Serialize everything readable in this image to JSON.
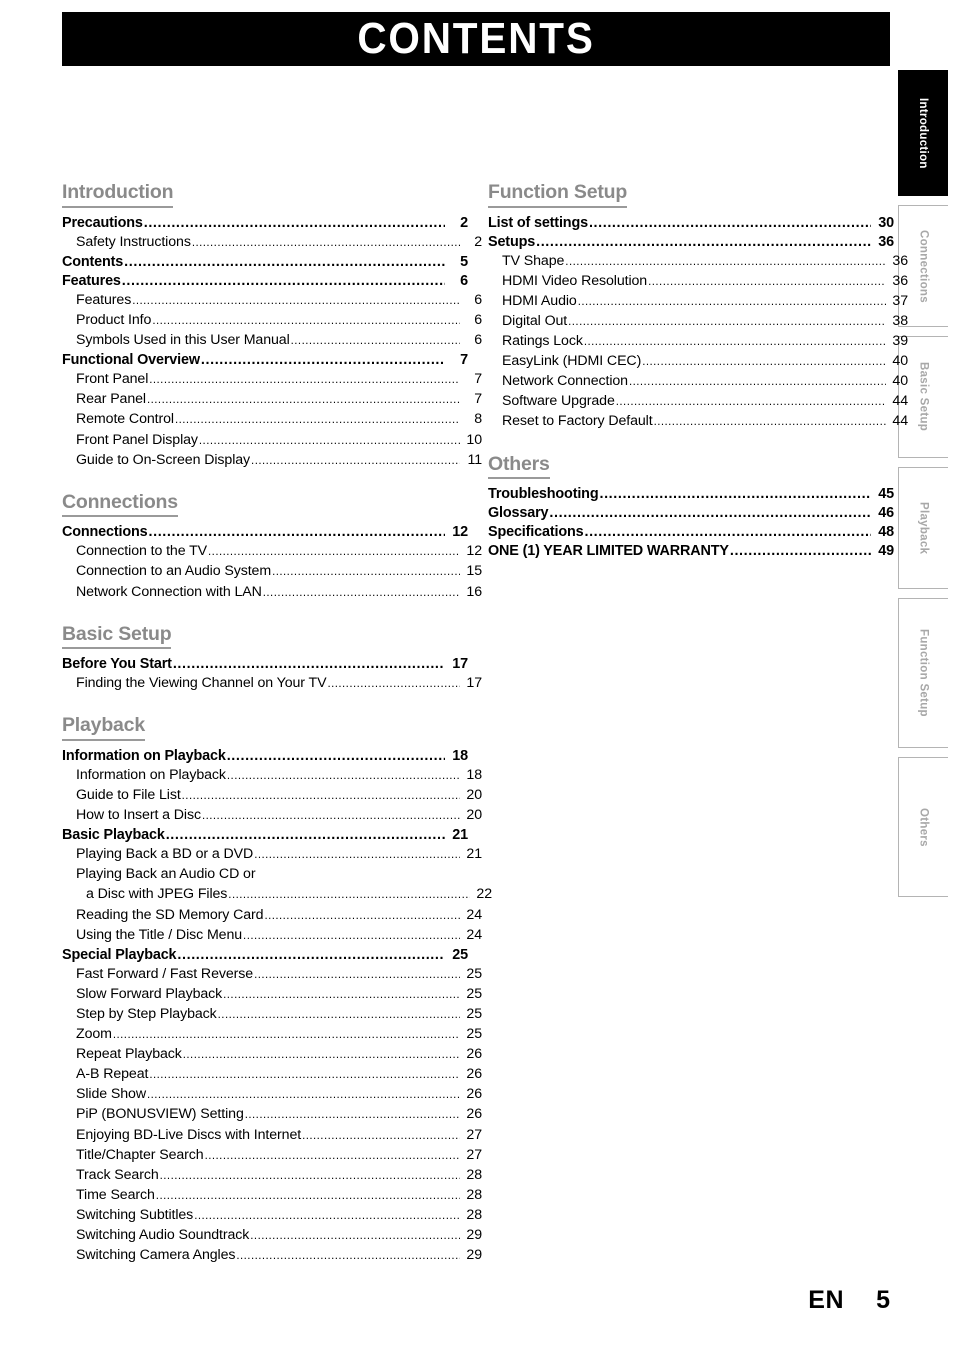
{
  "page": {
    "banner_title": "CONTENTS",
    "footer_lang": "EN",
    "footer_page": "5",
    "heading_color": "#8a8a8a",
    "active_tab_bg": "#000000",
    "inactive_tab_color": "#a8a8a8"
  },
  "side_tabs": [
    {
      "label": "Introduction",
      "active": true
    },
    {
      "label": "Connections",
      "active": false
    },
    {
      "label": "Basic Setup",
      "active": false
    },
    {
      "label": "Playback",
      "active": false
    },
    {
      "label": "Function Setup",
      "active": false
    },
    {
      "label": "Others",
      "active": false
    }
  ],
  "left_column": [
    {
      "heading": "Introduction",
      "entries": [
        {
          "level": 1,
          "label": "Precautions",
          "page": "2"
        },
        {
          "level": 2,
          "label": "Safety Instructions",
          "page": "2"
        },
        {
          "level": 1,
          "label": "Contents",
          "page": "5"
        },
        {
          "level": 1,
          "label": "Features",
          "page": "6"
        },
        {
          "level": 2,
          "label": "Features",
          "page": "6"
        },
        {
          "level": 2,
          "label": "Product Info",
          "page": "6"
        },
        {
          "level": 2,
          "label": "Symbols Used in this User Manual",
          "page": "6"
        },
        {
          "level": 1,
          "label": "Functional Overview",
          "page": "7"
        },
        {
          "level": 2,
          "label": "Front Panel",
          "page": "7"
        },
        {
          "level": 2,
          "label": "Rear Panel",
          "page": "7"
        },
        {
          "level": 2,
          "label": "Remote Control",
          "page": "8"
        },
        {
          "level": 2,
          "label": "Front Panel Display",
          "page": "10"
        },
        {
          "level": 2,
          "label": "Guide to On-Screen Display",
          "page": "11"
        }
      ]
    },
    {
      "heading": "Connections",
      "entries": [
        {
          "level": 1,
          "label": "Connections",
          "page": "12"
        },
        {
          "level": 2,
          "label": "Connection to the TV",
          "page": "12"
        },
        {
          "level": 2,
          "label": "Connection to an Audio System",
          "page": "15"
        },
        {
          "level": 2,
          "label": "Network Connection with LAN",
          "page": "16"
        }
      ]
    },
    {
      "heading": "Basic Setup",
      "entries": [
        {
          "level": 1,
          "label": "Before You Start",
          "page": "17"
        },
        {
          "level": 2,
          "label": "Finding the Viewing Channel on Your TV",
          "page": "17"
        }
      ]
    },
    {
      "heading": "Playback",
      "entries": [
        {
          "level": 1,
          "label": "Information on Playback",
          "page": "18"
        },
        {
          "level": 2,
          "label": "Information on Playback",
          "page": "18"
        },
        {
          "level": 2,
          "label": "Guide to File List",
          "page": "20"
        },
        {
          "level": 2,
          "label": "How to Insert a Disc",
          "page": "20"
        },
        {
          "level": 1,
          "label": "Basic Playback",
          "page": "21"
        },
        {
          "level": 2,
          "label": "Playing Back a BD or a DVD",
          "page": "21"
        },
        {
          "level": 2,
          "label": "Playing Back an Audio CD or",
          "page": "",
          "nodots": true
        },
        {
          "level": 2,
          "label": "a Disc with JPEG Files",
          "page": "22",
          "cont": true
        },
        {
          "level": 2,
          "label": "Reading the SD Memory Card",
          "page": "24"
        },
        {
          "level": 2,
          "label": "Using the Title / Disc Menu",
          "page": "24"
        },
        {
          "level": 1,
          "label": "Special Playback",
          "page": "25"
        },
        {
          "level": 2,
          "label": "Fast Forward / Fast Reverse",
          "page": "25"
        },
        {
          "level": 2,
          "label": "Slow Forward Playback",
          "page": "25"
        },
        {
          "level": 2,
          "label": "Step by Step Playback",
          "page": "25"
        },
        {
          "level": 2,
          "label": "Zoom",
          "page": "25"
        },
        {
          "level": 2,
          "label": "Repeat Playback",
          "page": "26"
        },
        {
          "level": 2,
          "label": "A-B Repeat",
          "page": "26"
        },
        {
          "level": 2,
          "label": "Slide Show",
          "page": "26"
        },
        {
          "level": 2,
          "label": "PiP (BONUSVIEW) Setting",
          "page": "26"
        },
        {
          "level": 2,
          "label": "Enjoying BD-Live Discs with Internet",
          "page": "27"
        },
        {
          "level": 2,
          "label": "Title/Chapter Search",
          "page": "27"
        },
        {
          "level": 2,
          "label": "Track Search",
          "page": "28"
        },
        {
          "level": 2,
          "label": "Time Search",
          "page": "28"
        },
        {
          "level": 2,
          "label": "Switching Subtitles",
          "page": "28"
        },
        {
          "level": 2,
          "label": "Switching Audio Soundtrack",
          "page": "29"
        },
        {
          "level": 2,
          "label": "Switching Camera Angles",
          "page": "29"
        }
      ]
    }
  ],
  "right_column": [
    {
      "heading": "Function Setup",
      "entries": [
        {
          "level": 1,
          "label": "List of settings",
          "page": "30"
        },
        {
          "level": 1,
          "label": "Setups",
          "page": "36"
        },
        {
          "level": 2,
          "label": "TV Shape",
          "page": "36"
        },
        {
          "level": 2,
          "label": "HDMI Video Resolution",
          "page": "36"
        },
        {
          "level": 2,
          "label": "HDMI Audio",
          "page": "37"
        },
        {
          "level": 2,
          "label": "Digital Out",
          "page": "38"
        },
        {
          "level": 2,
          "label": "Ratings Lock",
          "page": "39"
        },
        {
          "level": 2,
          "label": "EasyLink (HDMI CEC)",
          "page": "40"
        },
        {
          "level": 2,
          "label": "Network Connection",
          "page": "40"
        },
        {
          "level": 2,
          "label": "Software Upgrade",
          "page": "44"
        },
        {
          "level": 2,
          "label": "Reset to Factory Default",
          "page": "44"
        }
      ]
    },
    {
      "heading": "Others",
      "entries": [
        {
          "level": 1,
          "label": "Troubleshooting",
          "page": "45"
        },
        {
          "level": 1,
          "label": "Glossary",
          "page": "46"
        },
        {
          "level": 1,
          "label": "Specifications",
          "page": "48"
        },
        {
          "level": 1,
          "label": "ONE (1) YEAR LIMITED WARRANTY",
          "page": "49"
        }
      ]
    }
  ]
}
